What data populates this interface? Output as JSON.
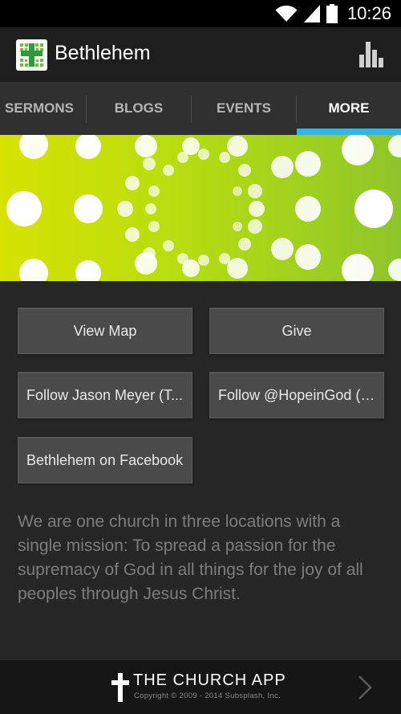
{
  "status_bar": {
    "time": "10:26",
    "icons": [
      "wifi-icon",
      "signal-icon",
      "battery-icon"
    ]
  },
  "action_bar": {
    "title": "Bethlehem",
    "logo_icon": "church-cross-logo-icon",
    "action_icon": "bar-chart-icon"
  },
  "tabs": [
    {
      "label": "SERMONS",
      "active": false
    },
    {
      "label": "BLOGS",
      "active": false
    },
    {
      "label": "EVENTS",
      "active": false
    },
    {
      "label": "MORE",
      "active": true
    }
  ],
  "banner": {
    "colors": {
      "left": "#d6e200",
      "right": "#8ec52a",
      "dots": "#ffffff"
    }
  },
  "buttons": {
    "view_map": "View Map",
    "give": "Give",
    "follow_jason": "Follow Jason Meyer (T...",
    "follow_hope": "Follow @HopeinGod (T...",
    "facebook": "Bethlehem on Facebook"
  },
  "mission": "We are one church in three locations with a single mission: To spread a passion for the supremacy of God in all things for the joy of all peoples through Jesus Christ.",
  "footer": {
    "title": "THE CHURCH APP",
    "copyright": "Copyright © 2009 - 2014 Subsplash, Inc.",
    "icons": [
      "cross-icon",
      "chevron-right-icon"
    ]
  },
  "colors": {
    "accent": "#33b5e5",
    "background": "#262626",
    "action_bar": "#1e1e1e",
    "tab_bar": "#303030",
    "button": "#4a4a4a"
  }
}
